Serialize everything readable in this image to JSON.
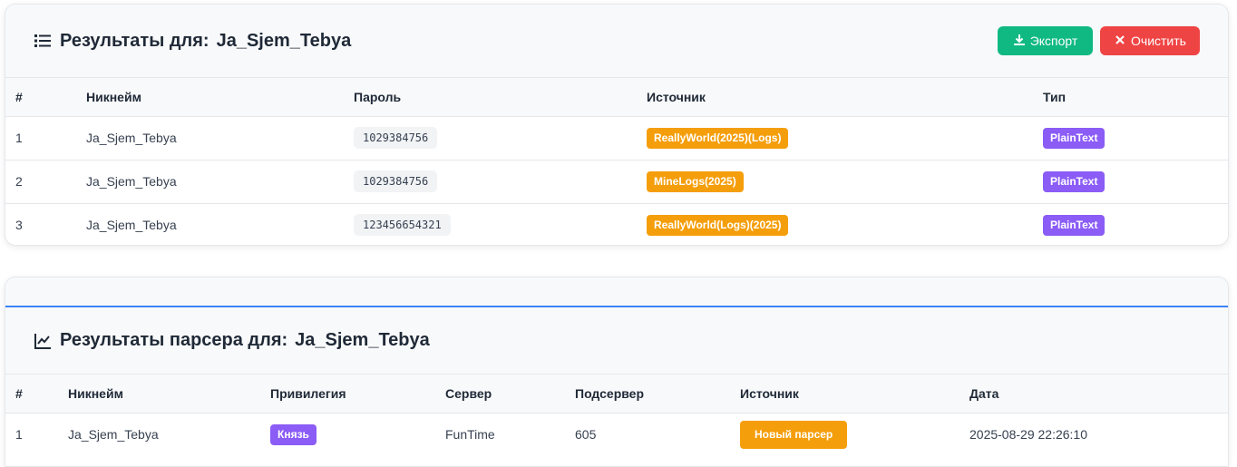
{
  "results": {
    "title": "Результаты для:",
    "query": "Ja_Sjem_Tebya",
    "export_label": "Экспорт",
    "clear_label": "Очистить",
    "columns": [
      "#",
      "Никнейм",
      "Пароль",
      "Источник",
      "Тип"
    ],
    "rows": [
      {
        "num": "1",
        "nick": "Ja_Sjem_Tebya",
        "password": "1029384756",
        "source": "ReallyWorld(2025)(Logs)",
        "type": "PlainText"
      },
      {
        "num": "2",
        "nick": "Ja_Sjem_Tebya",
        "password": "1029384756",
        "source": "MineLogs(2025)",
        "type": "PlainText"
      },
      {
        "num": "3",
        "nick": "Ja_Sjem_Tebya",
        "password": "123456654321",
        "source": "ReallyWorld(Logs)(2025)",
        "type": "PlainText"
      }
    ]
  },
  "parser": {
    "title": "Результаты парсера для:",
    "query": "Ja_Sjem_Tebya",
    "columns": [
      "#",
      "Никнейм",
      "Привилегия",
      "Сервер",
      "Подсервер",
      "Источник",
      "Дата"
    ],
    "rows": [
      {
        "num": "1",
        "nick": "Ja_Sjem_Tebya",
        "privilege": "Князь",
        "server": "FunTime",
        "subserver": "605",
        "source": "Новый парсер",
        "date": "2025-08-29 22:26:10"
      }
    ]
  },
  "icons": {
    "list": "list-icon",
    "chart": "chart-line-icon",
    "download": "download-icon",
    "close": "close-icon"
  },
  "colors": {
    "export": "#10b981",
    "clear": "#ef4444",
    "orange": "#f59e0b",
    "purple": "#8b5cf6",
    "accent": "#3b82f6"
  }
}
